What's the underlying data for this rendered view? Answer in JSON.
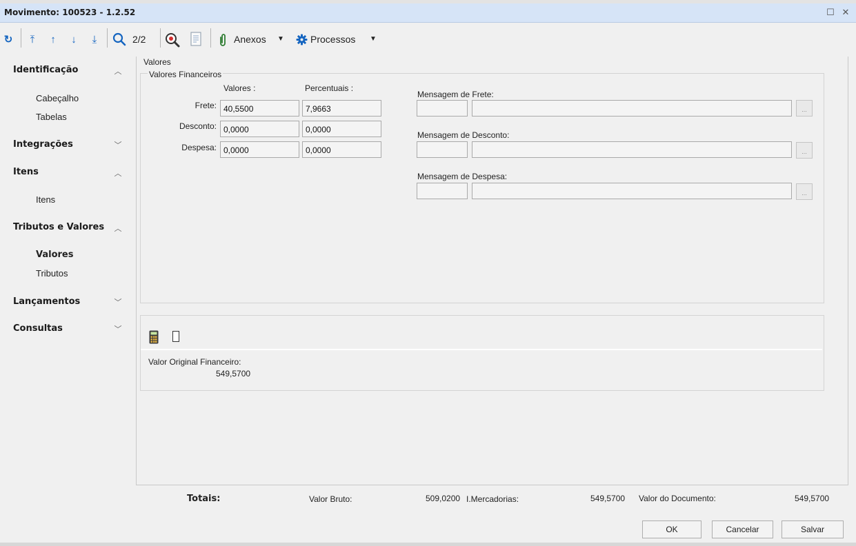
{
  "window": {
    "title": "Movimento: 100523 - 1.2.52",
    "maximize_glyph": "☐",
    "close_glyph": "✕"
  },
  "toolbar": {
    "refresh_icon": "↻",
    "first_icon": "⤒",
    "prev_icon": "↑",
    "next_icon": "↓",
    "last_icon": "⤓",
    "search_icon": "⌕",
    "record_position": "2/2",
    "anexos_label": "Anexos",
    "processos_label": "Processos",
    "dropdown_glyph": "▼"
  },
  "sidebar": {
    "sections": [
      {
        "label": "Identificação",
        "expanded": true,
        "items": [
          "Cabeçalho",
          "Tabelas"
        ]
      },
      {
        "label": "Integrações",
        "expanded": false,
        "items": []
      },
      {
        "label": "Itens",
        "expanded": true,
        "items": [
          "Itens"
        ]
      },
      {
        "label": "Tributos e Valores",
        "expanded": true,
        "items": [
          "Valores",
          "Tributos"
        ],
        "active_item": "Valores"
      },
      {
        "label": "Lançamentos",
        "expanded": false,
        "items": []
      },
      {
        "label": "Consultas",
        "expanded": false,
        "items": []
      }
    ],
    "chevron_up": "︿",
    "chevron_down": "﹀"
  },
  "valores": {
    "section_title": "Valores",
    "group_title": "Valores Financeiros",
    "col_valores": "Valores :",
    "col_percentuais": "Percentuais :",
    "rows": [
      {
        "label": "Frete:",
        "valor": "40,5500",
        "percentual": "7,9663"
      },
      {
        "label": "Desconto:",
        "valor": "0,0000",
        "percentual": "0,0000"
      },
      {
        "label": "Despesa:",
        "valor": "0,0000",
        "percentual": "0,0000"
      }
    ],
    "mensagens": [
      {
        "label": "Mensagem de Frete:",
        "code": "",
        "text": ""
      },
      {
        "label": "Mensagem de Desconto:",
        "code": "",
        "text": ""
      },
      {
        "label": "Mensagem de Despesa:",
        "code": "",
        "text": ""
      }
    ],
    "lookup_glyph": "..."
  },
  "financeiro": {
    "valor_original_label": "Valor Original Financeiro:",
    "valor_original": "549,5700"
  },
  "totais": {
    "label": "Totais:",
    "valor_bruto_label": "Valor Bruto:",
    "valor_bruto": "509,0200",
    "mercadorias_label": "I.Mercadorias:",
    "mercadorias": "549,5700",
    "valor_documento_label": "Valor do Documento:",
    "valor_documento": "549,5700"
  },
  "actions": {
    "ok": "OK",
    "cancelar": "Cancelar",
    "salvar": "Salvar"
  }
}
